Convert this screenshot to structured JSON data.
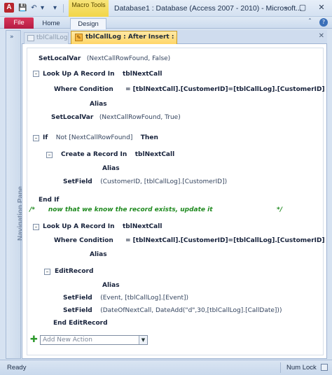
{
  "window": {
    "app_icon_letter": "A",
    "contextual_group": "Macro Tools",
    "title": "Database1 : Database (Access 2007 - 2010) - Microsoft...",
    "minimize": "–",
    "restore": "▢",
    "close": "✕"
  },
  "quick_access": {
    "save": "💾",
    "undo": "↶",
    "undo_dropdown": "▾",
    "customize": "▾"
  },
  "ribbon": {
    "tabs": [
      {
        "label": "File"
      },
      {
        "label": "Home"
      },
      {
        "label": "Design"
      }
    ],
    "minimize_icon": "ˆ",
    "help_icon": "?"
  },
  "nav_pane": {
    "label": "Navigation Pane",
    "expand": "»"
  },
  "doc_tabs": [
    {
      "label": "tblCallLog"
    },
    {
      "label": "tblCallLog : After Insert :"
    }
  ],
  "doc_close": "✕",
  "macro": {
    "line1": {
      "kw": "SetLocalVar",
      "args": "(NextCallRowFound, False)"
    },
    "block1": {
      "toggle": "–",
      "kw": "Look Up A Record In",
      "table": "tblNextCall",
      "where_kw": "Where Condition",
      "where_val": "= [tblNextCall].[CustomerID]=[tblCallLog].[CustomerID]",
      "alias_kw": "Alias",
      "setvar_kw": "SetLocalVar",
      "setvar_args": "(NextCallRowFound, True)"
    },
    "if_block": {
      "toggle": "–",
      "kw_if": "If",
      "condition": "Not [NextCallRowFound]",
      "kw_then": "Then",
      "create_toggle": "–",
      "create_kw": "Create a Record In",
      "create_table": "tblNextCall",
      "alias_kw": "Alias",
      "setfield_kw": "SetField",
      "setfield_args": "(CustomerID, [tblCallLog].[CustomerID])",
      "end_kw": "End If"
    },
    "comment": {
      "open": "/*",
      "text": "now that we know the record exists, update it",
      "close": "*/"
    },
    "block2": {
      "toggle": "–",
      "kw": "Look Up A Record In",
      "table": "tblNextCall",
      "where_kw": "Where Condition",
      "where_val": "= [tblNextCall].[CustomerID]=[tblCallLog].[CustomerID]",
      "alias_kw": "Alias",
      "edit_toggle": "–",
      "edit_kw": "EditRecord",
      "edit_alias_kw": "Alias",
      "setfield1_kw": "SetField",
      "setfield1_args": "(Event, [tblCallLog].[Event])",
      "setfield2_kw": "SetField",
      "setfield2_args": "(DateOfNextCall, DateAdd(\"d\",30,[tblCallLog].[CallDate]))",
      "end_edit_kw": "End EditRecord"
    },
    "add_action": {
      "plus": "✚",
      "placeholder": "Add New Action",
      "arrow": "▼"
    }
  },
  "status": {
    "left": "Ready",
    "right": "Num Lock"
  }
}
